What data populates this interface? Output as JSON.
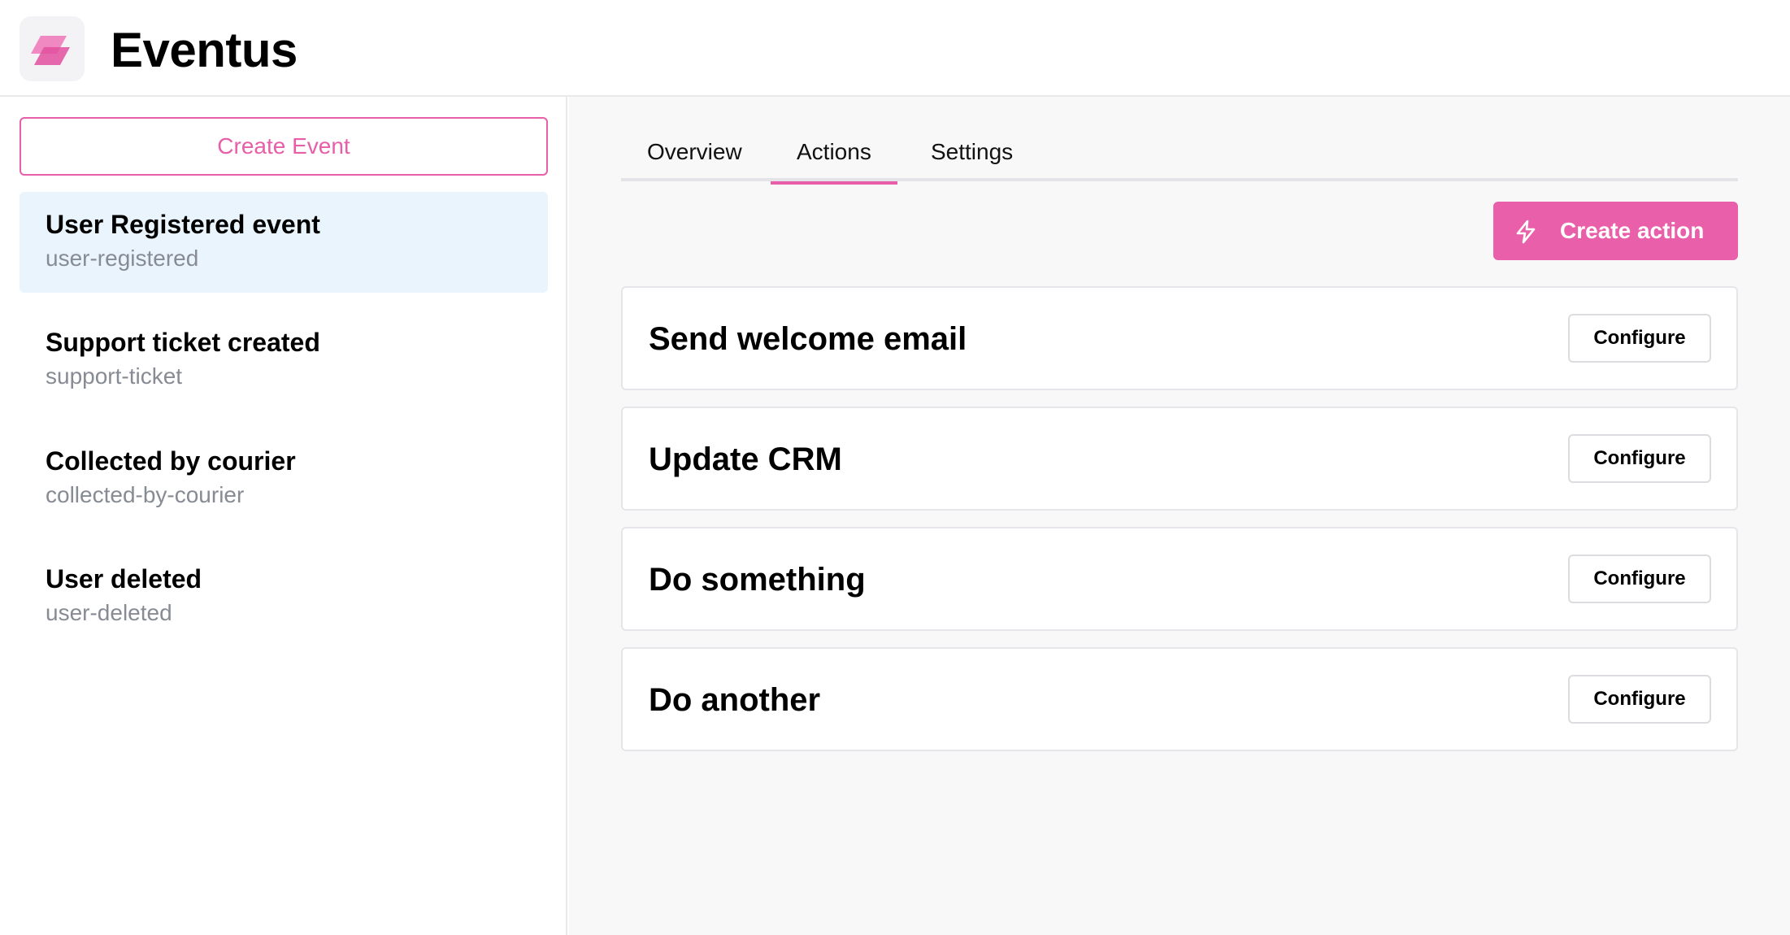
{
  "app": {
    "title": "Eventus",
    "logo_icon": "layers-logo-icon",
    "brand_color": "#e75fa8"
  },
  "sidebar": {
    "create_event_label": "Create Event",
    "events": [
      {
        "name": "User Registered event",
        "slug": "user-registered",
        "selected": true
      },
      {
        "name": "Support ticket created",
        "slug": "support-ticket",
        "selected": false
      },
      {
        "name": "Collected by courier",
        "slug": "collected-by-courier",
        "selected": false
      },
      {
        "name": "User deleted",
        "slug": "user-deleted",
        "selected": false
      }
    ]
  },
  "main": {
    "tabs": [
      {
        "label": "Overview",
        "active": false
      },
      {
        "label": "Actions",
        "active": true
      },
      {
        "label": "Settings",
        "active": false
      }
    ],
    "create_action_label": "Create action",
    "create_action_icon": "lightning-bolt-icon",
    "actions": [
      {
        "title": "Send welcome email",
        "button_label": "Configure"
      },
      {
        "title": "Update CRM",
        "button_label": "Configure"
      },
      {
        "title": "Do something",
        "button_label": "Configure"
      },
      {
        "title": "Do another",
        "button_label": "Configure"
      }
    ]
  }
}
